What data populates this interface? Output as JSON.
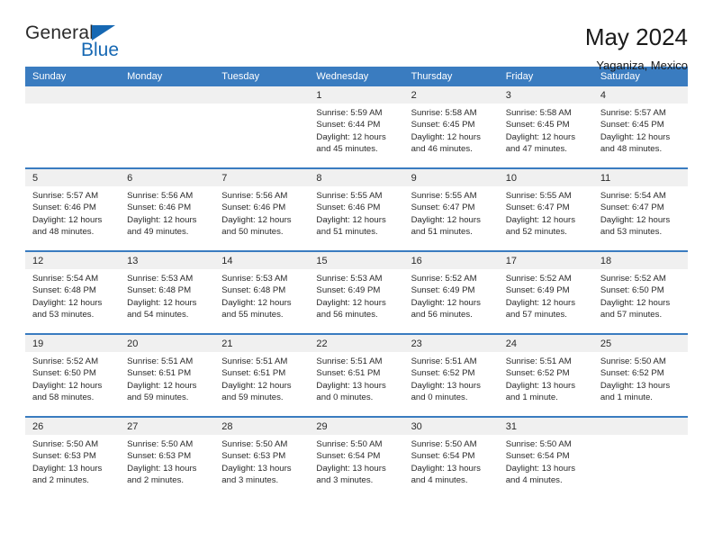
{
  "brand": {
    "name_part1": "General",
    "name_part2": "Blue",
    "accent_color": "#1668b3"
  },
  "header": {
    "title": "May 2024",
    "subtitle": "Yaganiza, Mexico"
  },
  "calendar": {
    "header_color": "#3a7cc0",
    "weekday_headers": [
      "Sunday",
      "Monday",
      "Tuesday",
      "Wednesday",
      "Thursday",
      "Friday",
      "Saturday"
    ],
    "weeks": [
      [
        {
          "day": "",
          "sunrise": "",
          "sunset": "",
          "daylight": ""
        },
        {
          "day": "",
          "sunrise": "",
          "sunset": "",
          "daylight": ""
        },
        {
          "day": "",
          "sunrise": "",
          "sunset": "",
          "daylight": ""
        },
        {
          "day": "1",
          "sunrise": "Sunrise: 5:59 AM",
          "sunset": "Sunset: 6:44 PM",
          "daylight": "Daylight: 12 hours and 45 minutes."
        },
        {
          "day": "2",
          "sunrise": "Sunrise: 5:58 AM",
          "sunset": "Sunset: 6:45 PM",
          "daylight": "Daylight: 12 hours and 46 minutes."
        },
        {
          "day": "3",
          "sunrise": "Sunrise: 5:58 AM",
          "sunset": "Sunset: 6:45 PM",
          "daylight": "Daylight: 12 hours and 47 minutes."
        },
        {
          "day": "4",
          "sunrise": "Sunrise: 5:57 AM",
          "sunset": "Sunset: 6:45 PM",
          "daylight": "Daylight: 12 hours and 48 minutes."
        }
      ],
      [
        {
          "day": "5",
          "sunrise": "Sunrise: 5:57 AM",
          "sunset": "Sunset: 6:46 PM",
          "daylight": "Daylight: 12 hours and 48 minutes."
        },
        {
          "day": "6",
          "sunrise": "Sunrise: 5:56 AM",
          "sunset": "Sunset: 6:46 PM",
          "daylight": "Daylight: 12 hours and 49 minutes."
        },
        {
          "day": "7",
          "sunrise": "Sunrise: 5:56 AM",
          "sunset": "Sunset: 6:46 PM",
          "daylight": "Daylight: 12 hours and 50 minutes."
        },
        {
          "day": "8",
          "sunrise": "Sunrise: 5:55 AM",
          "sunset": "Sunset: 6:46 PM",
          "daylight": "Daylight: 12 hours and 51 minutes."
        },
        {
          "day": "9",
          "sunrise": "Sunrise: 5:55 AM",
          "sunset": "Sunset: 6:47 PM",
          "daylight": "Daylight: 12 hours and 51 minutes."
        },
        {
          "day": "10",
          "sunrise": "Sunrise: 5:55 AM",
          "sunset": "Sunset: 6:47 PM",
          "daylight": "Daylight: 12 hours and 52 minutes."
        },
        {
          "day": "11",
          "sunrise": "Sunrise: 5:54 AM",
          "sunset": "Sunset: 6:47 PM",
          "daylight": "Daylight: 12 hours and 53 minutes."
        }
      ],
      [
        {
          "day": "12",
          "sunrise": "Sunrise: 5:54 AM",
          "sunset": "Sunset: 6:48 PM",
          "daylight": "Daylight: 12 hours and 53 minutes."
        },
        {
          "day": "13",
          "sunrise": "Sunrise: 5:53 AM",
          "sunset": "Sunset: 6:48 PM",
          "daylight": "Daylight: 12 hours and 54 minutes."
        },
        {
          "day": "14",
          "sunrise": "Sunrise: 5:53 AM",
          "sunset": "Sunset: 6:48 PM",
          "daylight": "Daylight: 12 hours and 55 minutes."
        },
        {
          "day": "15",
          "sunrise": "Sunrise: 5:53 AM",
          "sunset": "Sunset: 6:49 PM",
          "daylight": "Daylight: 12 hours and 56 minutes."
        },
        {
          "day": "16",
          "sunrise": "Sunrise: 5:52 AM",
          "sunset": "Sunset: 6:49 PM",
          "daylight": "Daylight: 12 hours and 56 minutes."
        },
        {
          "day": "17",
          "sunrise": "Sunrise: 5:52 AM",
          "sunset": "Sunset: 6:49 PM",
          "daylight": "Daylight: 12 hours and 57 minutes."
        },
        {
          "day": "18",
          "sunrise": "Sunrise: 5:52 AM",
          "sunset": "Sunset: 6:50 PM",
          "daylight": "Daylight: 12 hours and 57 minutes."
        }
      ],
      [
        {
          "day": "19",
          "sunrise": "Sunrise: 5:52 AM",
          "sunset": "Sunset: 6:50 PM",
          "daylight": "Daylight: 12 hours and 58 minutes."
        },
        {
          "day": "20",
          "sunrise": "Sunrise: 5:51 AM",
          "sunset": "Sunset: 6:51 PM",
          "daylight": "Daylight: 12 hours and 59 minutes."
        },
        {
          "day": "21",
          "sunrise": "Sunrise: 5:51 AM",
          "sunset": "Sunset: 6:51 PM",
          "daylight": "Daylight: 12 hours and 59 minutes."
        },
        {
          "day": "22",
          "sunrise": "Sunrise: 5:51 AM",
          "sunset": "Sunset: 6:51 PM",
          "daylight": "Daylight: 13 hours and 0 minutes."
        },
        {
          "day": "23",
          "sunrise": "Sunrise: 5:51 AM",
          "sunset": "Sunset: 6:52 PM",
          "daylight": "Daylight: 13 hours and 0 minutes."
        },
        {
          "day": "24",
          "sunrise": "Sunrise: 5:51 AM",
          "sunset": "Sunset: 6:52 PM",
          "daylight": "Daylight: 13 hours and 1 minute."
        },
        {
          "day": "25",
          "sunrise": "Sunrise: 5:50 AM",
          "sunset": "Sunset: 6:52 PM",
          "daylight": "Daylight: 13 hours and 1 minute."
        }
      ],
      [
        {
          "day": "26",
          "sunrise": "Sunrise: 5:50 AM",
          "sunset": "Sunset: 6:53 PM",
          "daylight": "Daylight: 13 hours and 2 minutes."
        },
        {
          "day": "27",
          "sunrise": "Sunrise: 5:50 AM",
          "sunset": "Sunset: 6:53 PM",
          "daylight": "Daylight: 13 hours and 2 minutes."
        },
        {
          "day": "28",
          "sunrise": "Sunrise: 5:50 AM",
          "sunset": "Sunset: 6:53 PM",
          "daylight": "Daylight: 13 hours and 3 minutes."
        },
        {
          "day": "29",
          "sunrise": "Sunrise: 5:50 AM",
          "sunset": "Sunset: 6:54 PM",
          "daylight": "Daylight: 13 hours and 3 minutes."
        },
        {
          "day": "30",
          "sunrise": "Sunrise: 5:50 AM",
          "sunset": "Sunset: 6:54 PM",
          "daylight": "Daylight: 13 hours and 4 minutes."
        },
        {
          "day": "31",
          "sunrise": "Sunrise: 5:50 AM",
          "sunset": "Sunset: 6:54 PM",
          "daylight": "Daylight: 13 hours and 4 minutes."
        },
        {
          "day": "",
          "sunrise": "",
          "sunset": "",
          "daylight": ""
        }
      ]
    ]
  }
}
